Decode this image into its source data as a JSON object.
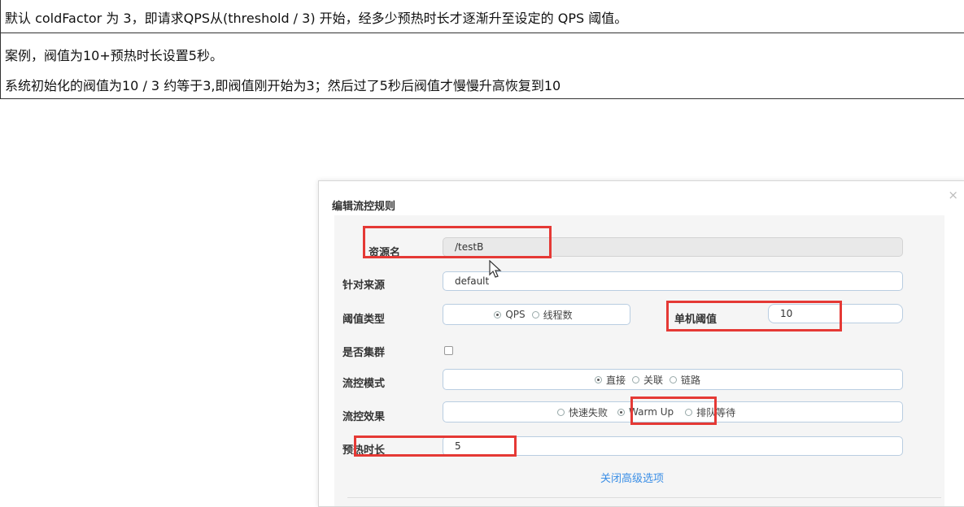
{
  "doc": {
    "line1": "默认 coldFactor 为 3，即请求QPS从(threshold / 3) 开始，经多少预热时长才逐渐升至设定的 QPS 阈值。",
    "line2": "案例，阀值为10+预热时长设置5秒。",
    "line3": "系统初始化的阀值为10 / 3 约等于3,即阀值刚开始为3；然后过了5秒后阀值才慢慢升高恢复到10"
  },
  "dialog": {
    "title": "编辑流控规则",
    "close_glyph": "×",
    "resource_label": "资源名",
    "resource_value": "/testB",
    "source_label": "针对来源",
    "source_value": "default",
    "threshold_type_label": "阈值类型",
    "threshold_types": [
      "QPS",
      "线程数"
    ],
    "threshold_type_selected": "QPS",
    "single_threshold_label": "单机阈值",
    "single_threshold_value": "10",
    "cluster_label": "是否集群",
    "cluster_checked": false,
    "mode_label": "流控模式",
    "modes": [
      "直接",
      "关联",
      "链路"
    ],
    "mode_selected": "直接",
    "effect_label": "流控效果",
    "effects": [
      "快速失败",
      "Warm Up",
      "排队等待"
    ],
    "effect_selected": "Warm Up",
    "warmup_label": "预热时长",
    "warmup_value": "5",
    "advanced_toggle": "关闭高级选项"
  },
  "colors": {
    "highlight": "#e53935",
    "link": "#3a8ee6",
    "field_border": "#b9cde1"
  }
}
